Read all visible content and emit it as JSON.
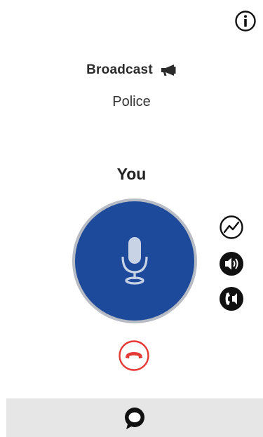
{
  "header": {
    "title": "Broadcast",
    "title_icon": "megaphone-icon",
    "info_icon": "info-icon"
  },
  "channel": {
    "name": "Police"
  },
  "speaker": {
    "label": "You"
  },
  "ptt": {
    "icon": "microphone-icon",
    "color": "#1d4a9b",
    "ring_color": "#b7bbc3"
  },
  "side_controls": {
    "icons": [
      "signal-icon",
      "speaker-volume-icon",
      "handset-audio-icon"
    ]
  },
  "end_call": {
    "icon": "end-call-icon",
    "color": "#e53935"
  },
  "bottom_bar": {
    "icon": "chat-bubble-icon",
    "background": "#e6e6e6"
  }
}
